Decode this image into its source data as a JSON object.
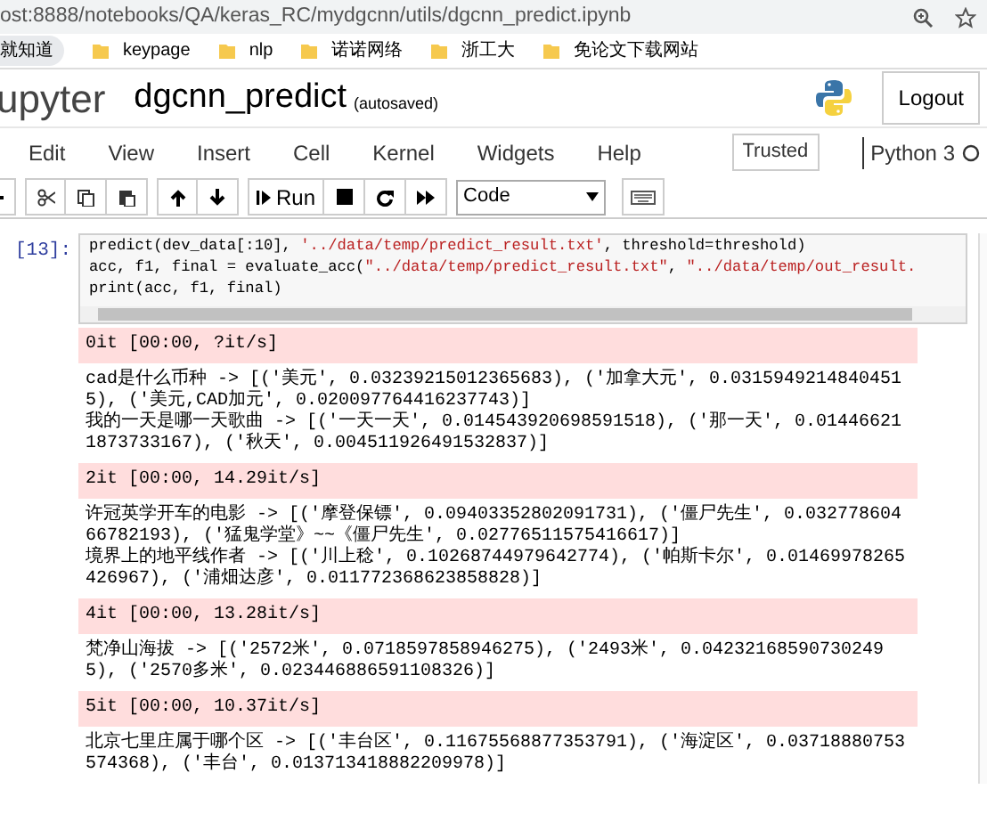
{
  "browser": {
    "url": "ost:8888/notebooks/QA/keras_RC/mydgcnn/utils/dgcnn_predict.ipynb",
    "bookmarks": [
      {
        "label": "就知道",
        "kind": "pill"
      },
      {
        "label": "keypage",
        "kind": "folder"
      },
      {
        "label": "nlp",
        "kind": "folder"
      },
      {
        "label": "诺诺网络",
        "kind": "folder"
      },
      {
        "label": "浙工大",
        "kind": "folder"
      },
      {
        "label": "免论文下载网站",
        "kind": "folder"
      }
    ]
  },
  "header": {
    "logo": "upyter",
    "notebook_name": "dgcnn_predict",
    "save_status": "(autosaved)",
    "logout": "Logout"
  },
  "menu": [
    "Edit",
    "View",
    "Insert",
    "Cell",
    "Kernel",
    "Widgets",
    "Help"
  ],
  "trusted": "Trusted",
  "kernel": {
    "name": "Python 3",
    "busy": false
  },
  "toolbar": {
    "run": "Run",
    "cell_type": "Code"
  },
  "cell": {
    "prompt": "[13]:",
    "code": [
      "predict(dev_data[:10], '../data/temp/predict_result.txt', threshold=threshold)",
      "acc, f1, final = evaluate_acc(\"../data/temp/predict_result.txt\", \"../data/temp/out_result.",
      "print(acc, f1, final)"
    ],
    "outputs": [
      {
        "kind": "stderr",
        "lines": [
          "0it [00:00, ?it/s]"
        ]
      },
      {
        "kind": "stdout",
        "lines": [
          "cad是什么币种 -> [('美元', 0.03239215012365683), ('加拿大元', 0.03159492148404515), ('美元,CAD加元', 0.020097764416237743)]",
          "我的一天是哪一天歌曲 -> [('一天一天', 0.014543920698591518), ('那一天', 0.014466211873733167), ('秋天', 0.004511926491532837)]"
        ]
      },
      {
        "kind": "stderr",
        "lines": [
          "2it [00:00, 14.29it/s]"
        ]
      },
      {
        "kind": "stdout",
        "lines": [
          "许冠英学开车的电影 -> [('摩登保镖', 0.09403352802091731), ('僵尸先生', 0.03277860466782193), ('猛鬼学堂》~~《僵尸先生', 0.02776511575416617)]",
          "境界上的地平线作者 -> [('川上稔', 0.10268744979642774), ('帕斯卡尔', 0.01469978265426967), ('浦畑达彦', 0.011772368623858828)]"
        ]
      },
      {
        "kind": "stderr",
        "lines": [
          "4it [00:00, 13.28it/s]"
        ]
      },
      {
        "kind": "stdout",
        "lines": [
          "梵净山海拔 -> [('2572米', 0.0718597858946275), ('2493米', 0.042321685907302495), ('2570多米', 0.023446886591108326)]"
        ]
      },
      {
        "kind": "stderr",
        "lines": [
          "5it [00:00, 10.37it/s]"
        ]
      },
      {
        "kind": "stdout",
        "lines": [
          "北京七里庄属于哪个区 -> [('丰台区', 0.11675568877353791), ('海淀区', 0.03718880753574368), ('丰台', 0.013713418882209978)]"
        ]
      }
    ]
  }
}
